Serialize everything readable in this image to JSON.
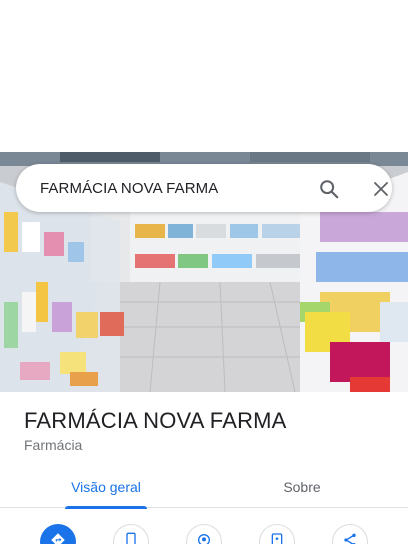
{
  "search": {
    "query": "FARMÁCIA NOVA FARMA"
  },
  "place": {
    "name": "FARMÁCIA NOVA FARMA",
    "category": "Farmácia"
  },
  "tabs": [
    {
      "label": "Visão geral",
      "active": true
    },
    {
      "label": "Sobre",
      "active": false
    }
  ],
  "actions": [
    {
      "icon": "directions-icon",
      "primary": true
    },
    {
      "icon": "phone-icon",
      "primary": false
    },
    {
      "icon": "location-pin-icon",
      "primary": false
    },
    {
      "icon": "save-icon",
      "primary": false
    },
    {
      "icon": "share-icon",
      "primary": false
    }
  ],
  "colors": {
    "accent": "#1a73e8",
    "text_primary": "#202124",
    "text_secondary": "#70757a",
    "tab_inactive": "#5f6368"
  }
}
